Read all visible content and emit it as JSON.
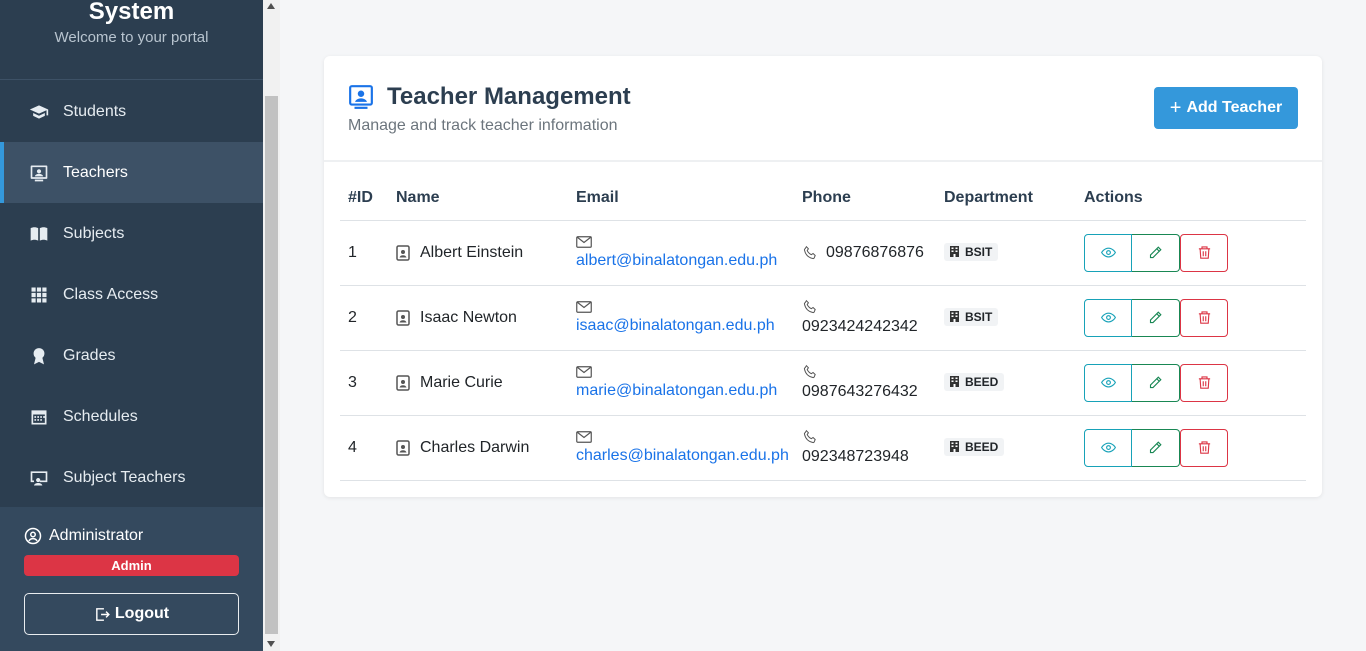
{
  "brand": {
    "title": "System",
    "subtitle": "Welcome to your portal"
  },
  "sidebar": {
    "items": [
      {
        "label": "Students",
        "icon": "graduation-cap-icon"
      },
      {
        "label": "Teachers",
        "icon": "teacher-board-icon",
        "active": true
      },
      {
        "label": "Subjects",
        "icon": "book-icon"
      },
      {
        "label": "Class Access",
        "icon": "grid-icon"
      },
      {
        "label": "Grades",
        "icon": "award-icon"
      },
      {
        "label": "Schedules",
        "icon": "calendar-icon"
      },
      {
        "label": "Subject Teachers",
        "icon": "person-screen-icon"
      }
    ]
  },
  "user": {
    "name": "Administrator",
    "role": "Admin",
    "logout_label": "Logout"
  },
  "header": {
    "title": "Teacher Management",
    "subtitle": "Manage and track teacher information",
    "add_button": "Add Teacher"
  },
  "table": {
    "columns": [
      "#ID",
      "Name",
      "Email",
      "Phone",
      "Department",
      "Actions"
    ],
    "rows": [
      {
        "id": "1",
        "name": "Albert Einstein",
        "email": "albert@binalatongan.edu.ph",
        "phone": "09876876876",
        "department": "BSIT"
      },
      {
        "id": "2",
        "name": "Isaac Newton",
        "email": "isaac@binalatongan.edu.ph",
        "phone": "0923424242342",
        "department": "BSIT"
      },
      {
        "id": "3",
        "name": "Marie Curie",
        "email": "marie@binalatongan.edu.ph",
        "phone": "0987643276432",
        "department": "BEED"
      },
      {
        "id": "4",
        "name": "Charles Darwin",
        "email": "charles@binalatongan.edu.ph",
        "phone": "092348723948",
        "department": "BEED"
      }
    ]
  },
  "colors": {
    "sidebar": "#2c3e50",
    "accent": "#3498db",
    "danger": "#dc3545",
    "success": "#198754",
    "info": "#17a2b8"
  }
}
